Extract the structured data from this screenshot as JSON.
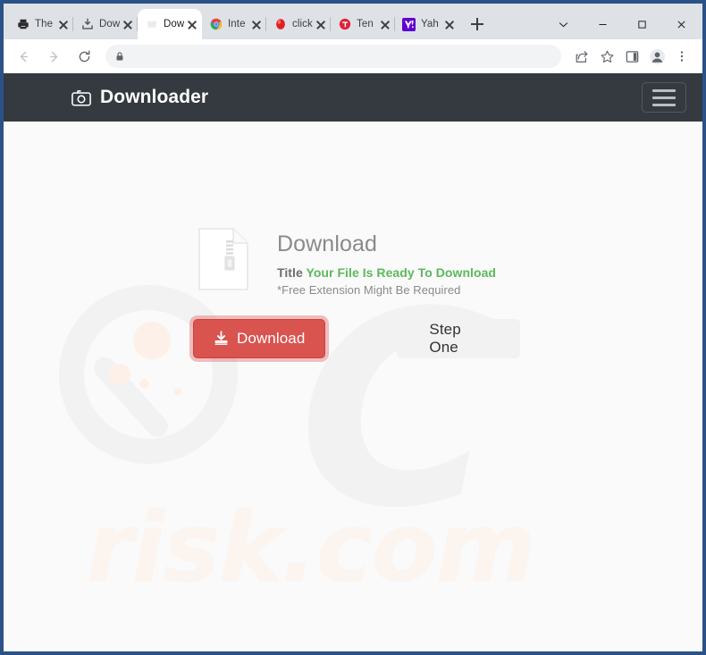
{
  "browser": {
    "tabs": [
      {
        "title": "The",
        "favicon": "printer-icon",
        "active": false
      },
      {
        "title": "Dow",
        "favicon": "download-icon",
        "active": false
      },
      {
        "title": "Dow",
        "favicon": "page-icon",
        "active": true
      },
      {
        "title": "Inte",
        "favicon": "chrome-icon",
        "active": false
      },
      {
        "title": "click",
        "favicon": "red-circle-icon",
        "active": false
      },
      {
        "title": "Ten",
        "favicon": "red-badge-icon",
        "active": false
      },
      {
        "title": "Yah",
        "favicon": "yahoo-icon",
        "active": false
      }
    ],
    "new_tab_label": "+",
    "window_controls": {
      "tab_search": "⌄",
      "minimize": "—",
      "maximize": "□",
      "close": "✕"
    },
    "toolbar": {
      "back": "back-arrow",
      "forward": "forward-arrow",
      "reload": "reload-icon",
      "url_value": "",
      "url_placeholder": "",
      "lock": "lock-icon",
      "share": "share-icon",
      "bookmark": "star-icon",
      "side_panel": "side-panel-icon",
      "profile": "profile-avatar-icon",
      "menu": "three-dot-menu-icon"
    }
  },
  "site": {
    "brand_name": "Downloader",
    "brand_icon": "camera-icon",
    "menu_toggle": "hamburger-menu",
    "header_bg": "#343a40"
  },
  "download_card": {
    "file_icon": "zip-file-icon",
    "heading": "Download",
    "title_label": "Title",
    "title_highlight": "Your File Is Ready To Download",
    "note": "*Free Extension Might Be Required",
    "primary_button": "Download",
    "primary_button_icon": "download-arrow-icon",
    "secondary_button": "Step One",
    "primary_color": "#d9534f",
    "highlight_color": "#5cb85c"
  },
  "watermark": {
    "logo_text": "C",
    "domain_text": "risk.com"
  }
}
